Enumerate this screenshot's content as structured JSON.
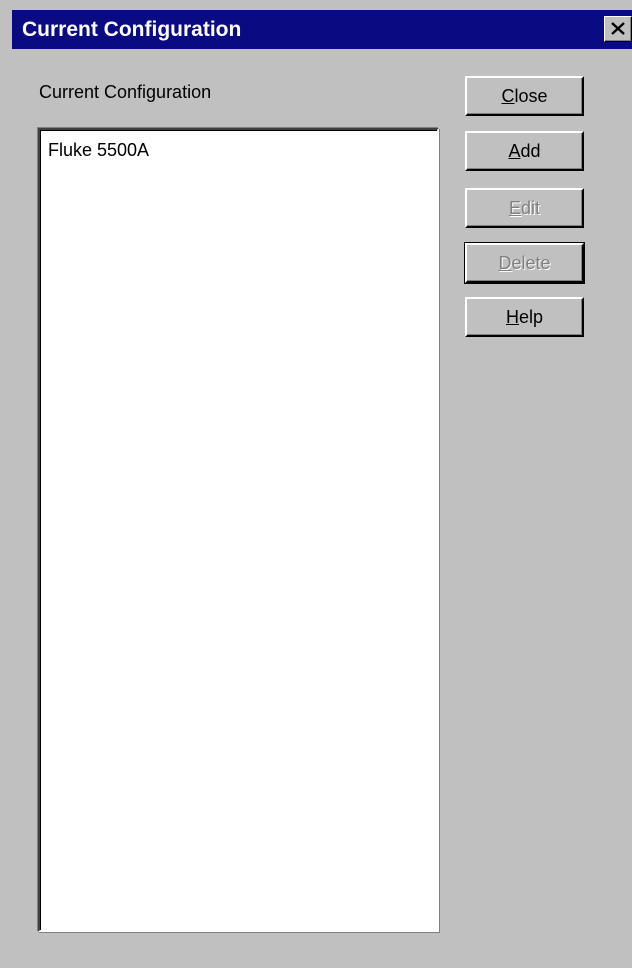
{
  "window": {
    "title": "Current Configuration"
  },
  "titlebar": {
    "close_icon": "close-x-icon"
  },
  "list": {
    "label": "Current Configuration",
    "items": [
      "Fluke 5500A"
    ]
  },
  "buttons": {
    "close": {
      "accel": "C",
      "rest": "lose",
      "enabled": true
    },
    "add": {
      "accel": "A",
      "rest": "dd",
      "enabled": true
    },
    "edit": {
      "accel": "E",
      "rest": "dit",
      "enabled": false
    },
    "delete": {
      "accel": "D",
      "rest": "elete",
      "enabled": false
    },
    "help": {
      "accel": "H",
      "rest": "elp",
      "enabled": true
    }
  },
  "colors": {
    "titlebar": "#0a0a82",
    "face": "#c0c0c0",
    "disabled_text": "#808080"
  }
}
